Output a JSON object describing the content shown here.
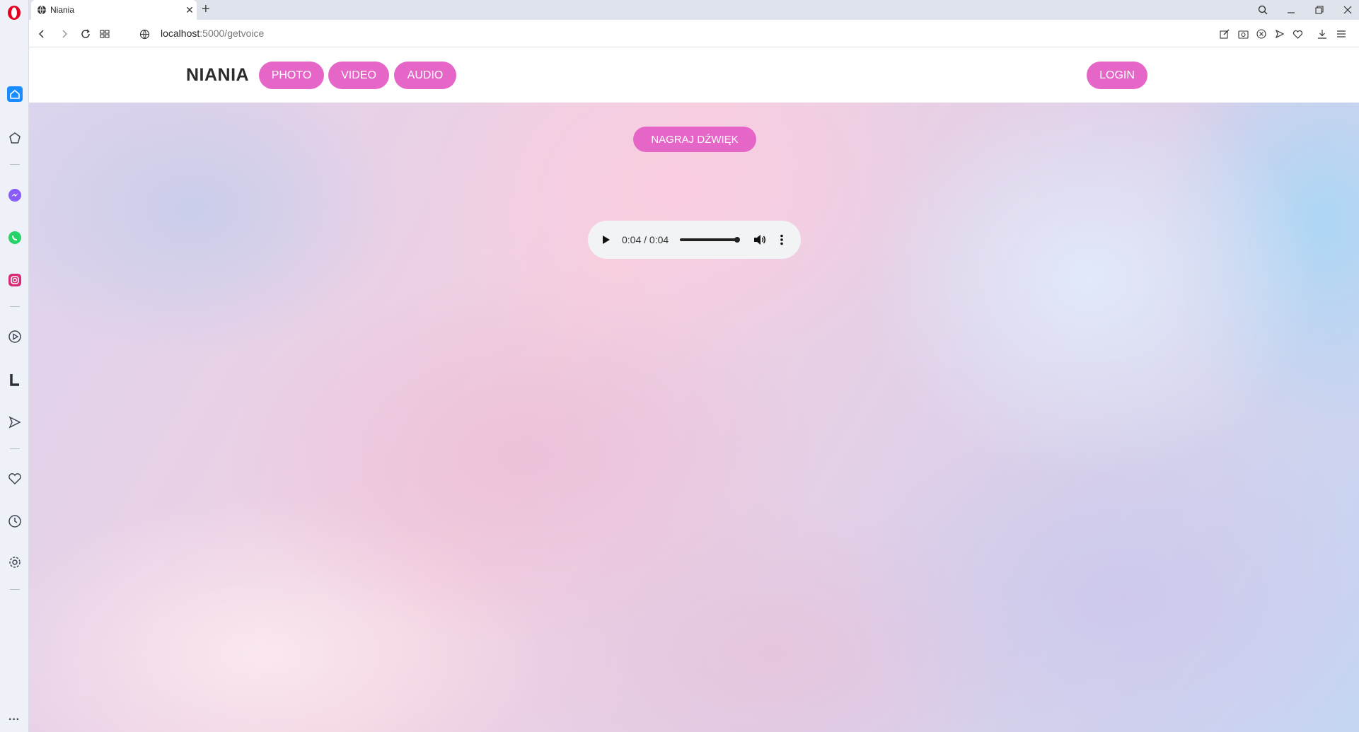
{
  "browser": {
    "tab_title": "Niania",
    "tab_close": "✕",
    "new_tab": "+",
    "url_host": "localhost",
    "url_rest": ":5000/getvoice",
    "brand_color": "#e5001f"
  },
  "sidebar": {
    "more": "···",
    "items": [
      "home-icon",
      "speed-dial-icon",
      "messenger-icon",
      "whatsapp-icon",
      "instagram-icon",
      "player-icon",
      "l-icon",
      "send-icon",
      "heart-icon",
      "history-icon",
      "settings-icon",
      "bulb-icon"
    ]
  },
  "navbar": {
    "brand": "NIANIA",
    "links": [
      "PHOTO",
      "VIDEO",
      "AUDIO"
    ],
    "login": "LOGIN",
    "accent_color": "#e666c8"
  },
  "main": {
    "record_button": "NAGRAJ DŹWIĘK",
    "audio": {
      "time": "0:04 / 0:04",
      "progress": 1.0
    }
  }
}
